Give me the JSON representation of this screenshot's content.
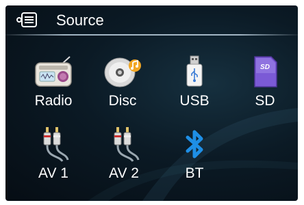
{
  "header": {
    "title": "Source",
    "icon": "list-menu-icon"
  },
  "sources": [
    {
      "id": "radio",
      "label": "Radio",
      "icon": "radio-icon"
    },
    {
      "id": "disc",
      "label": "Disc",
      "icon": "disc-icon"
    },
    {
      "id": "usb",
      "label": "USB",
      "icon": "usb-icon"
    },
    {
      "id": "sd",
      "label": "SD",
      "icon": "sd-card-icon"
    },
    {
      "id": "av1",
      "label": "AV 1",
      "icon": "av-cable-icon"
    },
    {
      "id": "av2",
      "label": "AV 2",
      "icon": "av-cable-icon"
    },
    {
      "id": "bt",
      "label": "BT",
      "icon": "bluetooth-icon"
    }
  ],
  "colors": {
    "background": "#0b1a25",
    "text": "#ffffff",
    "bluetooth": "#1e8fe6",
    "sd_card": "#6a4bc8"
  }
}
